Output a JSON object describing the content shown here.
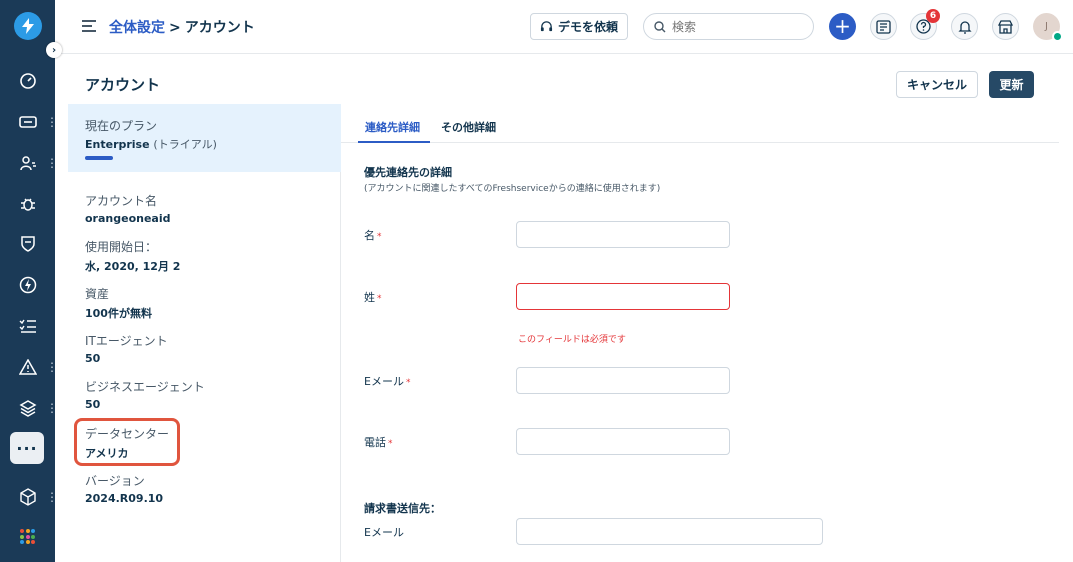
{
  "breadcrumb": {
    "parent": "全体設定",
    "separator": ">",
    "current": "アカウント"
  },
  "header": {
    "demo_label": "デモを依頼",
    "search_placeholder": "検索",
    "help_badge": "6",
    "avatar_initial": "J"
  },
  "page": {
    "title": "アカウント",
    "cancel_label": "キャンセル",
    "update_label": "更新"
  },
  "account": {
    "plan_label": "現在のプラン",
    "plan_name": "Enterprise",
    "plan_note": "(トライアル)",
    "fields": [
      {
        "key": "アカウント名",
        "value": "orangeoneaid"
      },
      {
        "key": "使用開始日：",
        "value": "水, 2020, 12月 2"
      },
      {
        "key": "資産",
        "value": "100件が無料"
      },
      {
        "key": "ITエージェント",
        "value": "50"
      },
      {
        "key": "ビジネスエージェント",
        "value": "50"
      },
      {
        "key": "データセンター",
        "value": "アメリカ"
      },
      {
        "key": "バージョン",
        "value": "2024.R09.10"
      }
    ]
  },
  "tabs": [
    {
      "label": "連絡先詳細",
      "active": true
    },
    {
      "label": "その他詳細",
      "active": false
    }
  ],
  "form": {
    "section_title": "優先連絡先の詳細",
    "section_sub": "(アカウントに関連したすべてのFreshserviceからの連絡に使用されます)",
    "first_name_label": "名",
    "last_name_label": "姓",
    "last_name_error": "このフィールドは必須です",
    "email_label": "Eメール",
    "phone_label": "電話",
    "required_mark": "*",
    "billing_title": "請求書送信先：",
    "billing_email_label": "Eメール"
  },
  "colors": {
    "rail": "#1b3a57",
    "accent": "#2c5cc5",
    "error": "#e43538",
    "highlight": "#e0553e"
  },
  "icons": [
    "bolt-logo-icon",
    "dashboard-icon",
    "ticket-icon",
    "users-icon",
    "bug-icon",
    "shield-icon",
    "lightning-icon",
    "checklist-icon",
    "alert-icon",
    "layers-icon",
    "more-icon",
    "cube-icon",
    "apps-grid-icon",
    "headset-icon",
    "search-icon",
    "contact-card-icon",
    "help-icon",
    "bell-icon",
    "store-icon"
  ]
}
